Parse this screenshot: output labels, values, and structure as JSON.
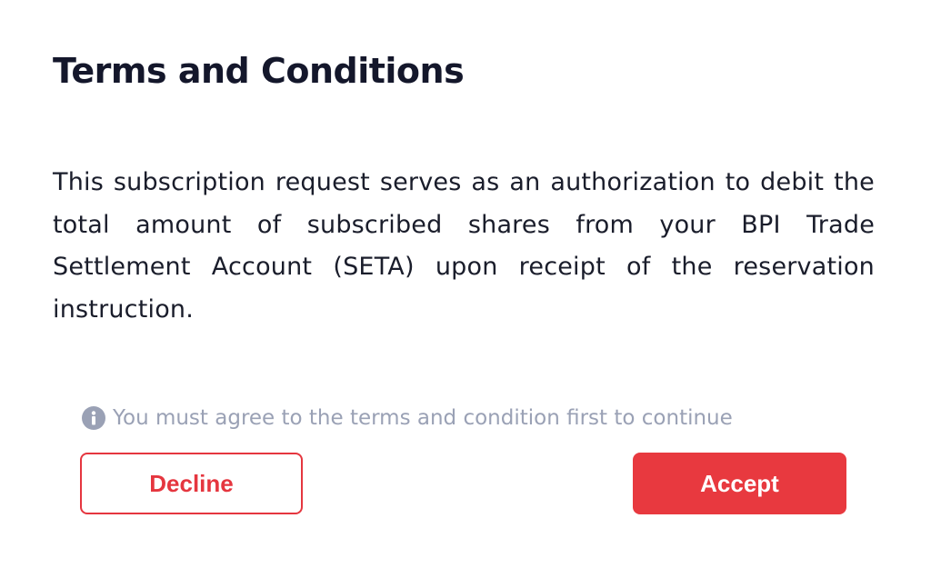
{
  "modal": {
    "title": "Terms and Conditions",
    "body": "This subscription request serves as an authorization to debit the total amount of subscribed shares from your BPI Trade Settlement Account (SETA) upon receipt of the reservation instruction.",
    "notice": {
      "icon": "info-icon",
      "text": "You must agree to the terms and condition first to continue"
    },
    "buttons": {
      "decline_label": "Decline",
      "accept_label": "Accept"
    }
  },
  "colors": {
    "accent": "#e8393f",
    "title": "#14172b",
    "muted": "#9aa1b5"
  }
}
